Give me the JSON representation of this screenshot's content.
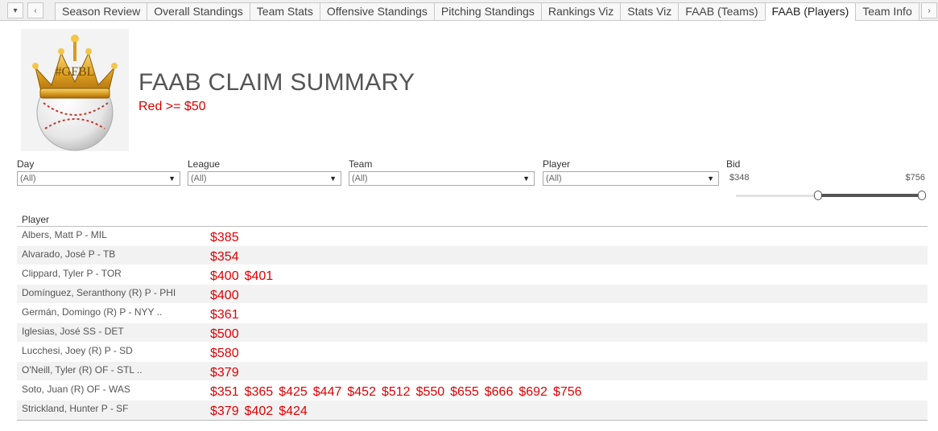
{
  "tabs": [
    {
      "label": "Season Review"
    },
    {
      "label": "Overall Standings"
    },
    {
      "label": "Team Stats"
    },
    {
      "label": "Offensive Standings"
    },
    {
      "label": "Pitching Standings"
    },
    {
      "label": "Rankings Viz"
    },
    {
      "label": "Stats Viz"
    },
    {
      "label": "FAAB (Teams)"
    },
    {
      "label": "FAAB (Players)",
      "active": true
    },
    {
      "label": "Team Info"
    },
    {
      "label": "S"
    }
  ],
  "nav": {
    "menu_icon": "▾",
    "prev_icon": "‹",
    "next_icon": "›"
  },
  "header": {
    "title": "FAAB CLAIM SUMMARY",
    "subtitle": "Red >= $50",
    "logo_text": "#GFBL"
  },
  "filters": {
    "day": {
      "label": "Day",
      "value": "(All)"
    },
    "league": {
      "label": "League",
      "value": "(All)"
    },
    "team": {
      "label": "Team",
      "value": "(All)"
    },
    "player": {
      "label": "Player",
      "value": "(All)"
    }
  },
  "bid": {
    "label": "Bid",
    "min": "$348",
    "max": "$756",
    "selected_low": 0.43,
    "selected_high": 1.0
  },
  "table": {
    "column_header": "Player",
    "rows": [
      {
        "player": "Albers, Matt P - MIL",
        "bids": [
          "$385"
        ]
      },
      {
        "player": "Alvarado, José P - TB",
        "bids": [
          "$354"
        ]
      },
      {
        "player": "Clippard, Tyler P - TOR",
        "bids": [
          "$400",
          "$401"
        ]
      },
      {
        "player": "Domínguez, Seranthony (R) P - PHI",
        "bids": [
          "$400"
        ]
      },
      {
        "player": "Germán, Domingo (R) P - NYY ..",
        "bids": [
          "$361"
        ]
      },
      {
        "player": "Iglesias, José SS - DET",
        "bids": [
          "$500"
        ]
      },
      {
        "player": "Lucchesi, Joey (R) P - SD",
        "bids": [
          "$580"
        ]
      },
      {
        "player": "O'Neill, Tyler (R) OF - STL ..",
        "bids": [
          "$379"
        ]
      },
      {
        "player": "Soto, Juan (R) OF - WAS",
        "bids": [
          "$351",
          "$365",
          "$425",
          "$447",
          "$452",
          "$512",
          "$550",
          "$655",
          "$666",
          "$692",
          "$756"
        ]
      },
      {
        "player": "Strickland, Hunter P - SF",
        "bids": [
          "$379",
          "$402",
          "$424"
        ]
      }
    ]
  },
  "colors": {
    "accent_red": "#e00000",
    "title_gray": "#555555"
  }
}
